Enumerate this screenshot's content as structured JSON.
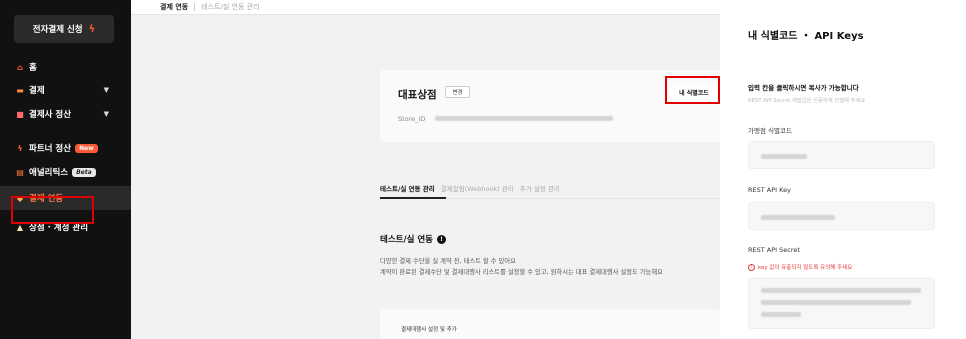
{
  "sidebar": {
    "apply_button": "전자결제 신청",
    "items": [
      {
        "label": "홈",
        "icon": "home-icon",
        "glyph": "⌂",
        "icon_color": "#ff5a36",
        "chevron": false
      },
      {
        "label": "결제",
        "icon": "card-icon",
        "glyph": "▬",
        "icon_color": "#ff8a3d",
        "chevron": true
      },
      {
        "label": "결제사 정산",
        "icon": "wallet-icon",
        "glyph": "■",
        "icon_color": "#ff6b6b",
        "chevron": true
      },
      {
        "label": "파트너 정산",
        "icon": "bolt-icon",
        "glyph": "ϟ",
        "icon_color": "#ff5a36",
        "chevron": false,
        "badge": "New"
      },
      {
        "label": "애널리틱스",
        "icon": "chart-icon",
        "glyph": "▤",
        "icon_color": "#ff7a3d",
        "chevron": false,
        "badge": "Beta"
      },
      {
        "label": "결제 연동",
        "icon": "link-icon",
        "glyph": "◆",
        "icon_color": "#ffb347",
        "chevron": false,
        "active": true
      },
      {
        "label": "상점 · 계정 관리",
        "icon": "store-icon",
        "glyph": "▲",
        "icon_color": "#f5deb3",
        "chevron": false
      }
    ]
  },
  "topbar": {
    "active": "결제 연동",
    "inactive": "테스트/실 연동 관리"
  },
  "store": {
    "name": "대표상점",
    "change_button": "변경",
    "id_label": "Store_ID",
    "id_button": "내 식별코드"
  },
  "tabs": [
    "테스트/실 연동 관리",
    "결제알림(Webhook) 관리",
    "추가 설정 관리"
  ],
  "section": {
    "title": "테스트/실 연동",
    "desc_line1": "다양한 결제 수단을 실 계약 전, 테스트 할 수 있어요",
    "desc_line2": "계약이 완료된 결제수단 및 결제대행사 리스트를 설정할 수 있고, 원하시는 대표 결제대행사 설정도 가능해요",
    "panel_label": "결제대행사 설정 및 추가"
  },
  "panel": {
    "title": "내 식별코드 ・ API Keys",
    "head": "입력 칸을 클릭하시면 복사가 가능합니다",
    "sub": "REST API Secret 재발급은 신중하게 진행해 주세요",
    "store_code_label": "가맹점 식별코드",
    "api_key_label": "REST API Key",
    "api_secret_label": "REST API Secret",
    "warning": "key 값이 유출되지 않도록 유의해 주세요"
  },
  "colors": {
    "sidebar_bg": "#111111",
    "accent": "#ff5a36",
    "highlight_box": "#e00000",
    "warning": "#e53935"
  }
}
